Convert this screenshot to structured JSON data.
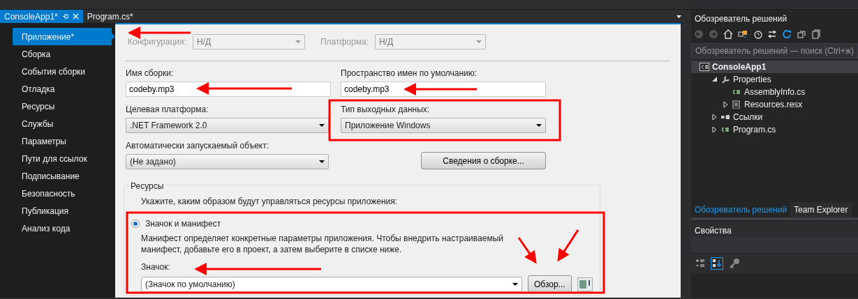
{
  "document_tabs": [
    {
      "label": "ConsoleApp1*",
      "selected": true,
      "pinnable": true
    },
    {
      "label": "Program.cs*",
      "selected": false,
      "pinnable": false
    }
  ],
  "nav": {
    "items": [
      {
        "label": "Приложение*",
        "selected": true
      },
      {
        "label": "Сборка",
        "selected": false
      },
      {
        "label": "События сборки",
        "selected": false
      },
      {
        "label": "Отладка",
        "selected": false
      },
      {
        "label": "Ресурсы",
        "selected": false
      },
      {
        "label": "Службы",
        "selected": false
      },
      {
        "label": "Параметры",
        "selected": false
      },
      {
        "label": "Пути для ссылок",
        "selected": false
      },
      {
        "label": "Подписывание",
        "selected": false
      },
      {
        "label": "Безопасность",
        "selected": false
      },
      {
        "label": "Публикация",
        "selected": false
      },
      {
        "label": "Анализ кода",
        "selected": false
      }
    ]
  },
  "properties_page": {
    "configuration": {
      "label": "Конфигурация:",
      "value": "Н/Д",
      "disabled": true
    },
    "platform": {
      "label": "Платформа:",
      "value": "Н/Д",
      "disabled": true
    },
    "assembly_name": {
      "label": "Имя сборки:",
      "value": "codeby.mp3"
    },
    "default_namespace": {
      "label": "Пространство имен по умолчанию:",
      "value": "codeby.mp3"
    },
    "target_framework": {
      "label": "Целевая платформа:",
      "value": ".NET Framework 2.0"
    },
    "output_type": {
      "label": "Тип выходных данных:",
      "value": "Приложение Windows"
    },
    "startup_object": {
      "label": "Автоматически запускаемый объект:",
      "value": "(Не задано)"
    },
    "assembly_info_button": "Сведения о сборке...",
    "resources": {
      "title": "Ресурсы",
      "hint": "Укажите, каким образом будут управляться ресурсы приложения:",
      "option": {
        "label": "Значок и манифест",
        "selected": true
      },
      "description": "Манифест определяет конкретные параметры приложения. Чтобы внедрить настраиваемый манифест, добавьте его в проект, а затем выберите в списке ниже.",
      "icon_label": "Значок:",
      "icon_value": "(Значок по умолчанию)",
      "browse_button": "Обзор..."
    }
  },
  "solution_explorer": {
    "title": "Обозреватель решений",
    "search": {
      "placeholder": "Обозреватель решений — поиск (Ctrl+ж)"
    },
    "tree": [
      {
        "label": "ConsoleApp1",
        "kind": "project",
        "selected": true,
        "children": [
          {
            "label": "Properties",
            "kind": "properties",
            "selected": false,
            "expanded": true,
            "children": [
              {
                "label": "AssemblyInfo.cs",
                "kind": "csharp",
                "selected": false
              },
              {
                "label": "Resources.resx",
                "kind": "resx",
                "selected": false,
                "expanded": false
              }
            ]
          },
          {
            "label": "Ссылки",
            "kind": "references",
            "selected": false,
            "expanded": false
          },
          {
            "label": "Program.cs",
            "kind": "csharp",
            "selected": false,
            "expanded": false
          }
        ]
      }
    ]
  },
  "bottom_tabs": [
    {
      "label": "Обозреватель решений",
      "selected": true
    },
    {
      "label": "Team Explorer",
      "selected": false
    }
  ],
  "properties_panel": {
    "title": "Свойства"
  }
}
